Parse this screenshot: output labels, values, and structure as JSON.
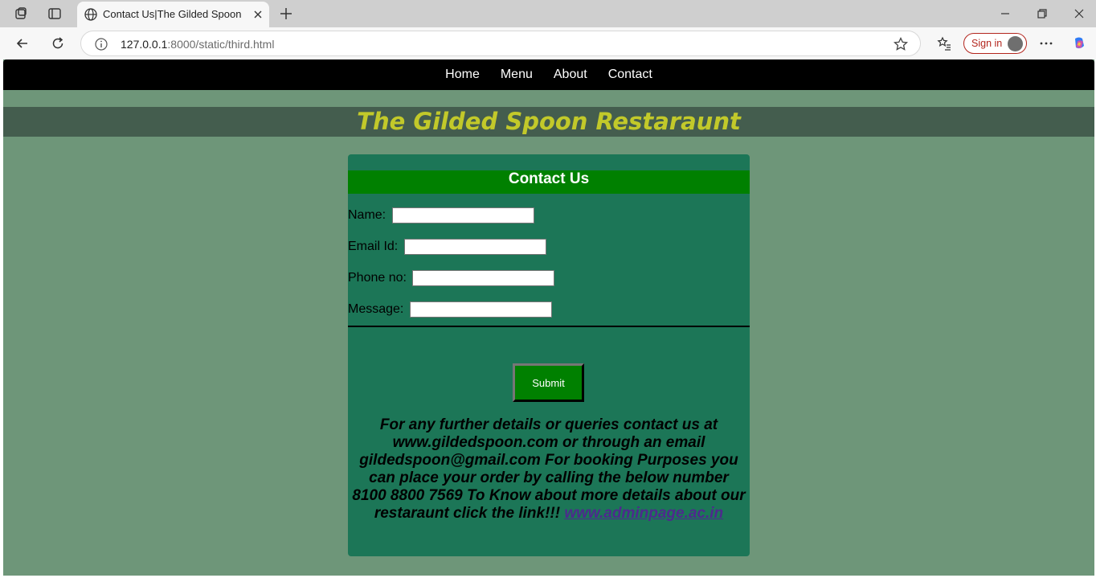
{
  "browser": {
    "tab_title": "Contact Us|The Gilded Spoon",
    "url_host": "127.0.0.1",
    "url_path": ":8000/static/third.html",
    "signin_label": "Sign in"
  },
  "site": {
    "nav": [
      "Home",
      "Menu",
      "About",
      "Contact"
    ],
    "title": "The Gilded Spoon Restaraunt"
  },
  "form": {
    "heading": "Contact Us",
    "fields": [
      {
        "label": "Name:",
        "value": ""
      },
      {
        "label": "Email Id:",
        "value": ""
      },
      {
        "label": "Phone no:",
        "value": ""
      },
      {
        "label": "Message:",
        "value": ""
      }
    ],
    "submit_label": "Submit"
  },
  "info": {
    "text": "For any further details or queries contact us at www.gildedspoon.com or through an email gildedspoon@gmail.com For booking Purposes you can place your order by calling the below number 8100 8800 7569 To Know about more details about our restaraunt click the link!!!",
    "link_text": "www.adminpage.ac.in"
  },
  "colors": {
    "page_bg": "#6e9679",
    "banner_bg": "#445d4e",
    "title_color": "#c2c92a",
    "card_bg": "#1c7657",
    "header_green": "#008000"
  }
}
